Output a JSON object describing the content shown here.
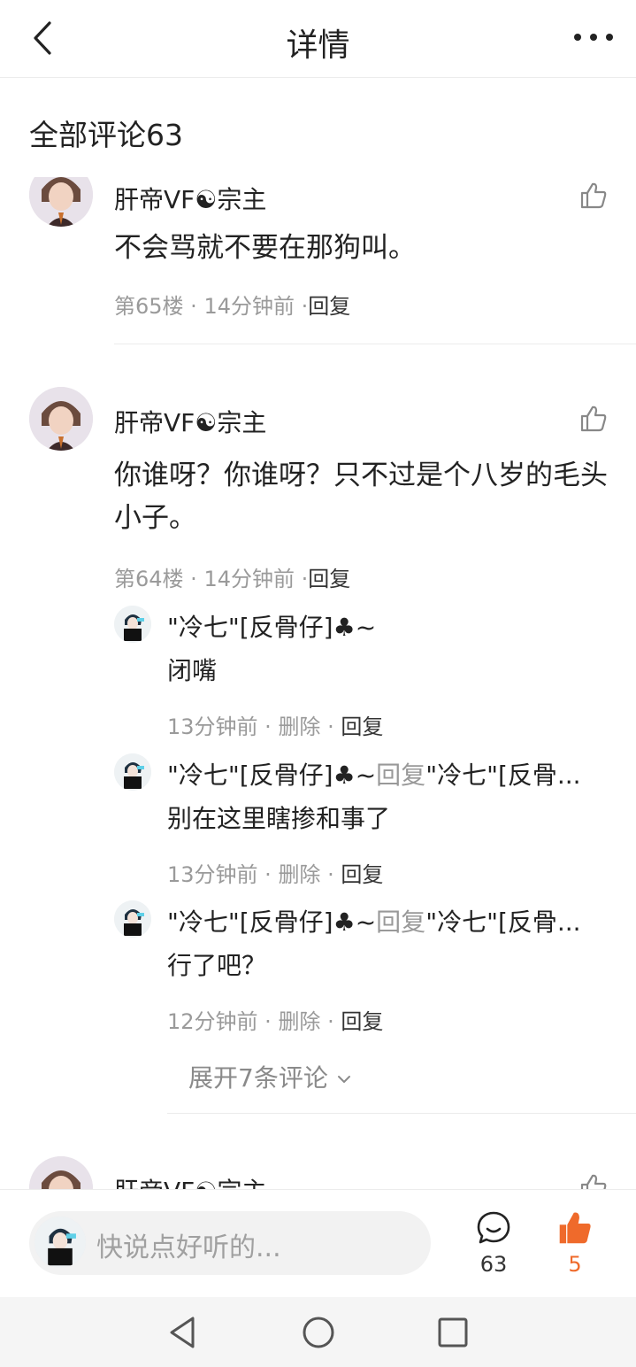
{
  "header": {
    "title": "详情"
  },
  "section": {
    "title": "全部评论63"
  },
  "comments": [
    {
      "author": "肝帝VF☯宗主",
      "text": "不会骂就不要在那狗叫。",
      "floor": "第65楼",
      "time": "14分钟前",
      "reply_label": "回复"
    },
    {
      "author": "肝帝VF☯宗主",
      "text": "你谁呀？你谁呀？只不过是个八岁的毛头小子。",
      "floor": "第64楼",
      "time": "14分钟前",
      "reply_label": "回复",
      "replies": [
        {
          "author": "\"冷七\"[反骨仔]♣~",
          "reply_word": "",
          "target": "",
          "text": "闭嘴",
          "time": "13分钟前",
          "delete_label": "删除",
          "reply_label": "回复"
        },
        {
          "author": "\"冷七\"[反骨仔]♣~",
          "reply_word": "回复",
          "target": "\"冷七\"[反骨...",
          "text": "别在这里瞎掺和事了",
          "time": "13分钟前",
          "delete_label": "删除",
          "reply_label": "回复"
        },
        {
          "author": "\"冷七\"[反骨仔]♣~",
          "reply_word": "回复",
          "target": "\"冷七\"[反骨...",
          "text": "行了吧？",
          "time": "12分钟前",
          "delete_label": "删除",
          "reply_label": "回复"
        }
      ],
      "expand_label": "展开7条评论"
    },
    {
      "author": "肝帝VF☯宗主"
    }
  ],
  "bottom_bar": {
    "placeholder": "快说点好听的...",
    "comment_count": "63",
    "like_count": "5"
  },
  "icons": {
    "back": "chevron-left-icon",
    "more": "more-dots-icon",
    "like": "thumbs-up-icon",
    "comment": "speech-bubble-icon",
    "liked": "thumbs-up-filled-icon",
    "expand": "chevron-down-icon"
  },
  "colors": {
    "accent": "#ef6a2b",
    "meta_text": "#9a9a9a",
    "divider": "#ececec"
  }
}
